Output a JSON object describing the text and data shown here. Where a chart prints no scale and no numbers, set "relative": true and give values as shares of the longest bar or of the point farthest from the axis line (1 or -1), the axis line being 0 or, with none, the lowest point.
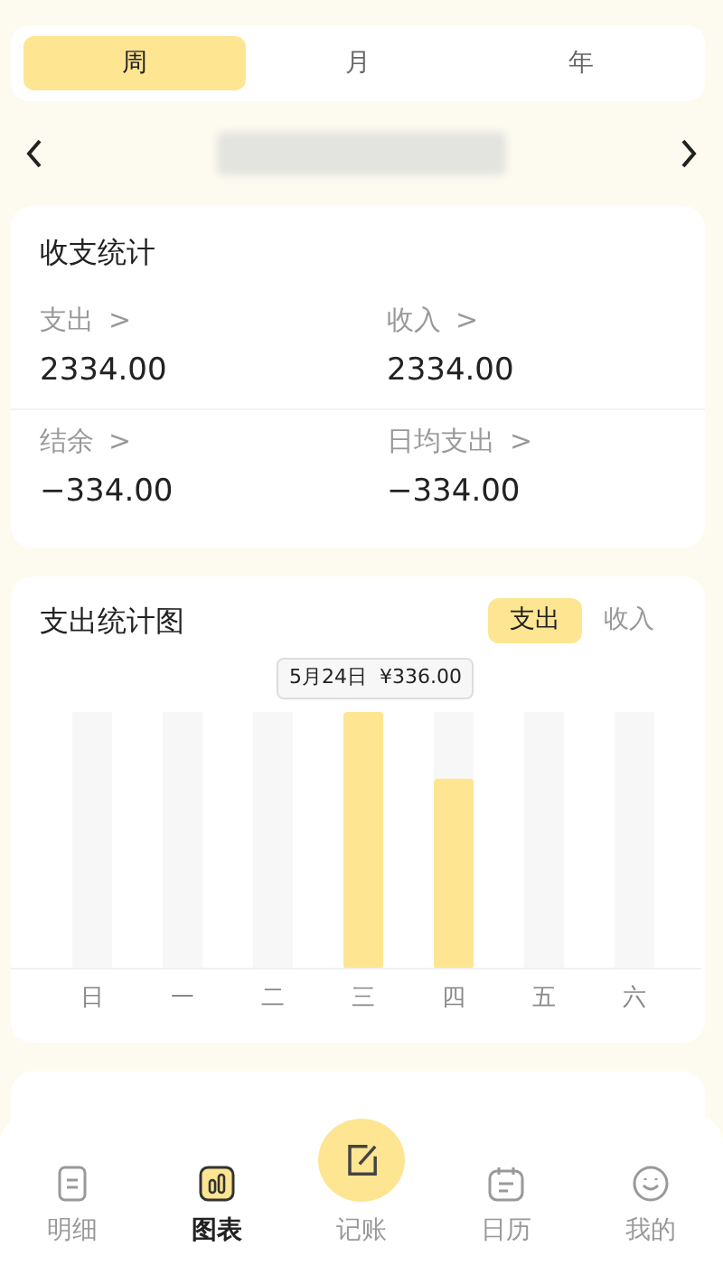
{
  "period_tabs": [
    {
      "label": "周",
      "selected": true
    },
    {
      "label": "月",
      "selected": false
    },
    {
      "label": "年",
      "selected": false
    }
  ],
  "summary": {
    "title": "收支统计",
    "stats": [
      {
        "label": "支出",
        "arrow": ">",
        "value": "2334.00"
      },
      {
        "label": "收入",
        "arrow": ">",
        "value": "2334.00"
      },
      {
        "label": "结余",
        "arrow": ">",
        "value": "−334.00"
      },
      {
        "label": "日均支出",
        "arrow": ">",
        "value": "−334.00"
      }
    ]
  },
  "chart_card": {
    "title": "支出统计图",
    "toggle": [
      {
        "label": "支出",
        "selected": true
      },
      {
        "label": "收入",
        "selected": false
      }
    ],
    "tooltip": "5月24日  ¥336.00",
    "chart_data": {
      "type": "bar",
      "relative": true,
      "categories": [
        "日",
        "一",
        "二",
        "三",
        "四",
        "五",
        "六"
      ],
      "values": [
        0,
        0,
        0,
        1,
        0.74,
        0,
        0
      ]
    }
  },
  "tab_bar": [
    {
      "label": "明细",
      "selected": false
    },
    {
      "label": "图表",
      "selected": true
    },
    {
      "label": "记账",
      "selected": false,
      "kind": "center"
    },
    {
      "label": "日历",
      "selected": false
    },
    {
      "label": "我的",
      "selected": false
    }
  ]
}
